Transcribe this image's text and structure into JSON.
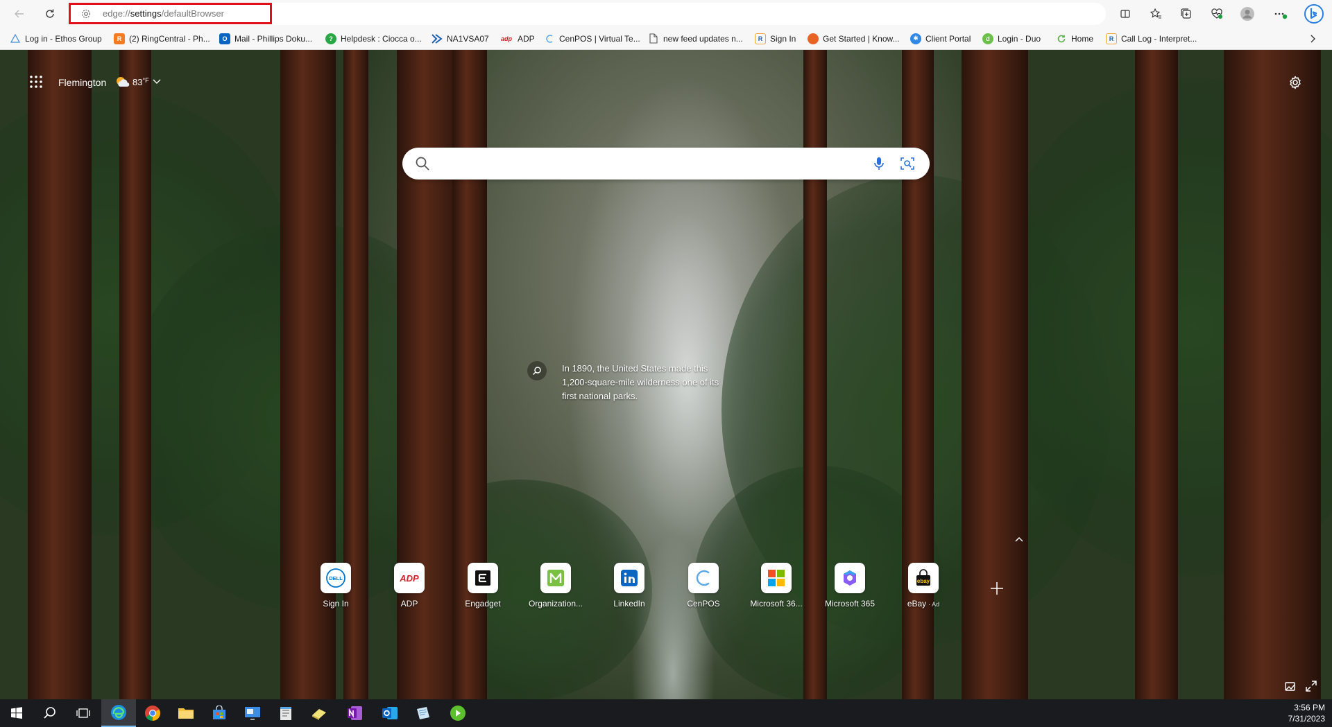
{
  "address_bar": {
    "url_scheme": "edge://",
    "url_host": "settings",
    "url_path": "/defaultBrowser"
  },
  "favorites": [
    {
      "label": "Log in - Ethos Group",
      "icon": "ethos-triangle-icon",
      "color": "#4b8ed8"
    },
    {
      "label": "(2) RingCentral - Ph...",
      "icon": "ringcentral-icon",
      "color": "#f47b20"
    },
    {
      "label": "Mail - Phillips Doku...",
      "icon": "outlook-icon",
      "color": "#0a64c2"
    },
    {
      "label": "Helpdesk : Ciocca o...",
      "icon": "helpdesk-icon",
      "color": "#27a844"
    },
    {
      "label": "NA1VSA07",
      "icon": "kaseya-icon",
      "color": "#1f5fb5"
    },
    {
      "label": "ADP",
      "icon": "adp-icon",
      "color": "#d61f26"
    },
    {
      "label": "CenPOS | Virtual Te...",
      "icon": "cenpos-icon",
      "color": "#5aa7e8"
    },
    {
      "label": "new feed updates n...",
      "icon": "document-icon",
      "color": "#555555"
    },
    {
      "label": "Sign In",
      "icon": "r-icon",
      "color": "#f2a33a"
    },
    {
      "label": "Get Started | Know...",
      "icon": "circle-orange-icon",
      "color": "#e86424"
    },
    {
      "label": "Client Portal",
      "icon": "client-portal-icon",
      "color": "#2f87e6"
    },
    {
      "label": "Login - Duo",
      "icon": "duo-icon",
      "color": "#6cc04a"
    },
    {
      "label": "Home",
      "icon": "home-refresh-icon",
      "color": "#5fb04f"
    },
    {
      "label": "Call Log - Interpret...",
      "icon": "r-icon",
      "color": "#f2a33a"
    }
  ],
  "header": {
    "location": "Flemington",
    "temperature": "83",
    "temp_unit": "°F"
  },
  "search": {
    "placeholder": ""
  },
  "caption": {
    "text": "In 1890, the United States made this 1,200-square-mile wilderness one of its first national parks."
  },
  "quick_links": [
    {
      "label": "Sign In",
      "icon": "dell-logo-icon",
      "color": "#0076ce"
    },
    {
      "label": "ADP",
      "icon": "adp-logo-icon",
      "color": "#d61f26"
    },
    {
      "label": "Engadget",
      "icon": "engadget-logo-icon",
      "color": "#111111"
    },
    {
      "label": "Organization...",
      "icon": "m-logo-icon",
      "color": "#7ac143"
    },
    {
      "label": "LinkedIn",
      "icon": "linkedin-logo-icon",
      "color": "#0a66c2"
    },
    {
      "label": "CenPOS",
      "icon": "cenpos-logo-icon",
      "color": "#5aa7e8"
    },
    {
      "label": "Microsoft 36...",
      "icon": "microsoft-logo-icon",
      "color": "#f25022"
    },
    {
      "label": "Microsoft 365",
      "icon": "m365-logo-icon",
      "color": "#8a5cf6"
    },
    {
      "label": "eBay",
      "ad": "· Ad",
      "icon": "ebay-logo-icon",
      "color": "#e53238"
    }
  ],
  "logo_text": {
    "dell": "DELL",
    "adp": "ADP",
    "engadget": "E",
    "ebay": "ebay"
  },
  "clock": {
    "time": "3:56 PM",
    "date": "7/31/2023"
  },
  "colors": {
    "address_highlight": "#e0101a",
    "toolbar_bg": "#f7f7f7",
    "taskbar_bg": "#1a1b1e"
  }
}
